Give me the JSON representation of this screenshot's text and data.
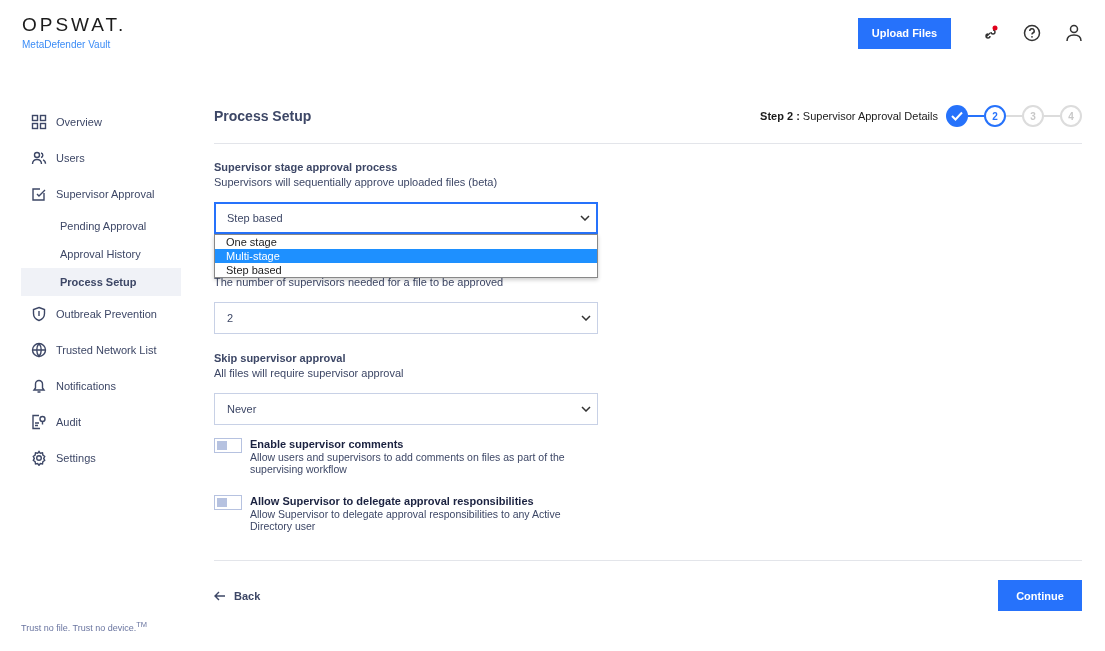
{
  "header": {
    "logo": "OPSWAT.",
    "product": "MetaDefender Vault",
    "upload_button": "Upload Files"
  },
  "sidebar": {
    "items": [
      {
        "label": "Overview",
        "kind": "grid",
        "selected": false
      },
      {
        "label": "Users",
        "kind": "users",
        "selected": false
      },
      {
        "label": "Supervisor Approval",
        "kind": "approval",
        "selected": false,
        "children": [
          {
            "label": "Pending Approval",
            "selected": false
          },
          {
            "label": "Approval History",
            "selected": false
          },
          {
            "label": "Process Setup",
            "selected": true
          }
        ]
      },
      {
        "label": "Outbreak Prevention",
        "kind": "shield",
        "selected": false
      },
      {
        "label": "Trusted Network List",
        "kind": "globe",
        "selected": false
      },
      {
        "label": "Notifications",
        "kind": "bell",
        "selected": false
      },
      {
        "label": "Audit",
        "kind": "audit",
        "selected": false
      },
      {
        "label": "Settings",
        "kind": "gear",
        "selected": false
      }
    ],
    "tagline": "Trust no file. Trust no device.$^{TM}$"
  },
  "page": {
    "title": "Process Setup",
    "step_label": "Step 2 :",
    "step_name": "Supervisor Approval Details",
    "steps": [
      {
        "completed": true,
        "selected": false
      },
      {
        "label": "2",
        "completed": false,
        "selected": true
      },
      {
        "label": "3",
        "completed": false,
        "selected": false
      },
      {
        "label": "4",
        "completed": false,
        "selected": false
      }
    ]
  },
  "fields": [
    {
      "label": "Supervisor stage approval process",
      "description": "Supervisors will sequentially approve uploaded files (beta)",
      "value": "Step based",
      "focused": true,
      "options": [
        {
          "label": "One stage",
          "highlighted": false
        },
        {
          "label": "Multi-stage",
          "highlighted": true
        },
        {
          "label": "Step based",
          "highlighted": false
        }
      ]
    },
    {
      "description": "The number of supervisors needed for a file to be approved",
      "value": "2",
      "focused": false
    },
    {
      "label": "Skip supervisor approval",
      "description": "All files will require supervisor approval",
      "value": "Never",
      "focused": false
    }
  ],
  "toggles": [
    {
      "label": "Enable supervisor comments",
      "description": "Allow users and supervisors to add comments on files as part of the supervising workflow",
      "on": false
    },
    {
      "label": "Allow Supervisor to delegate approval responsibilities",
      "description": "Allow Supervisor to delegate approval responsibilities to any Active Directory user",
      "on": false
    }
  ],
  "footer": {
    "back": "Back",
    "continue": "Continue"
  }
}
